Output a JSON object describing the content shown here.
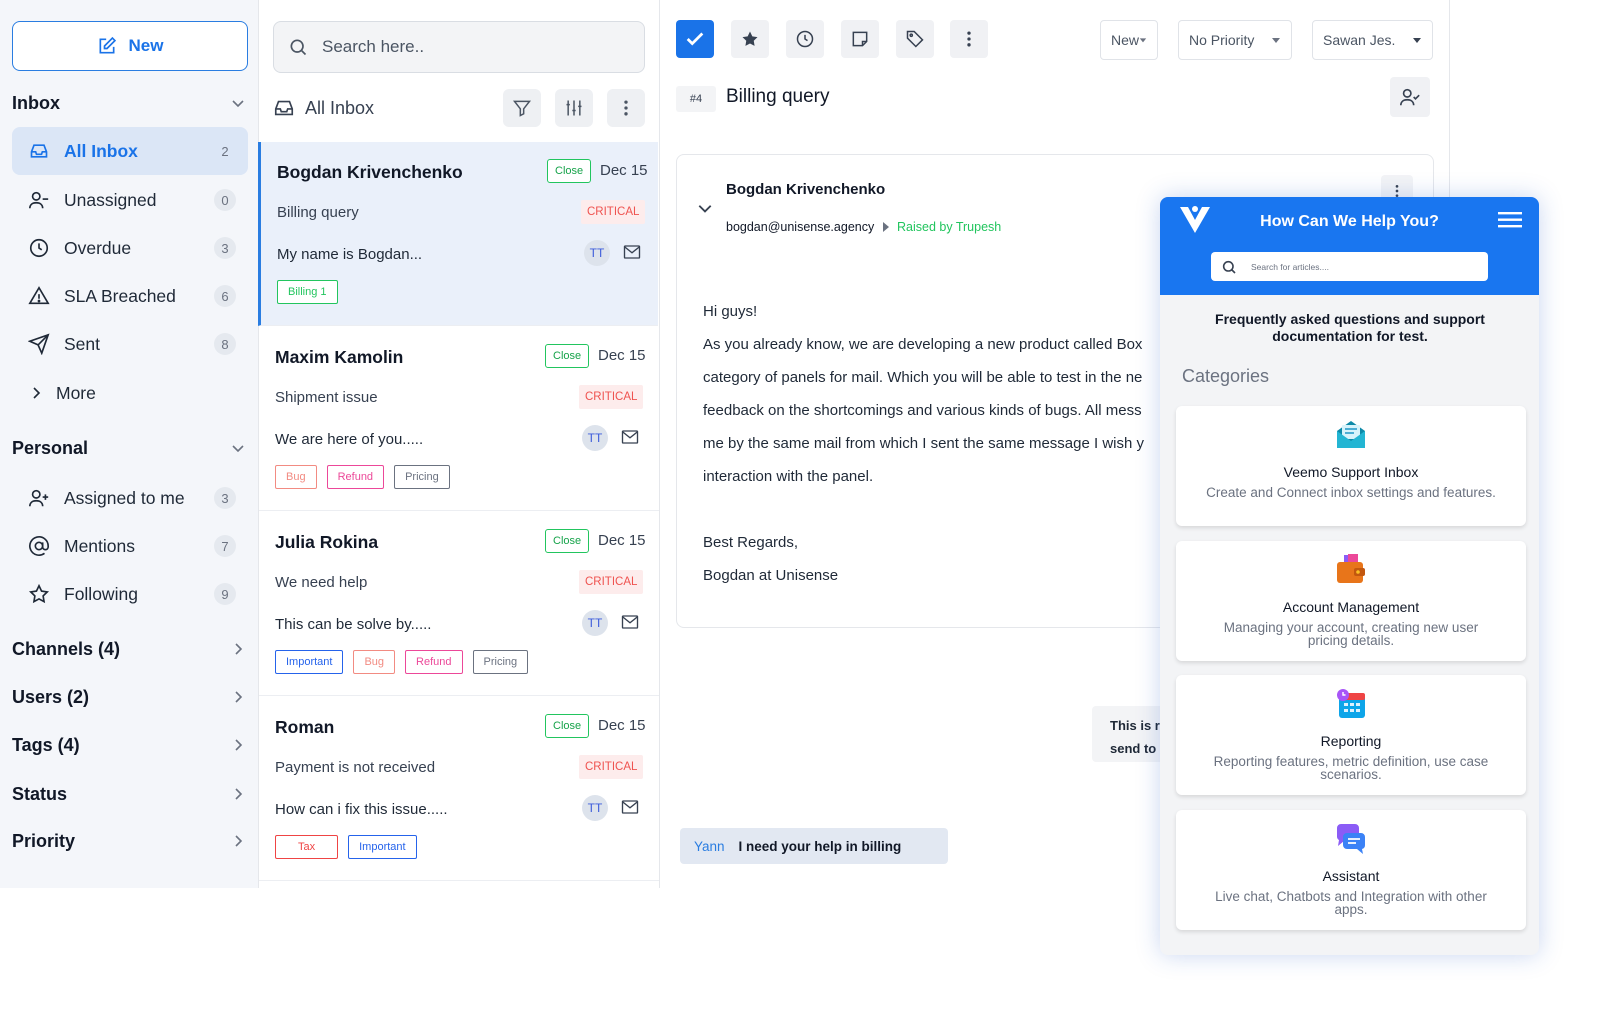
{
  "sidebar": {
    "new_label": "New",
    "inbox_header": "Inbox",
    "inbox_items": [
      {
        "label": "All Inbox",
        "count": "2"
      },
      {
        "label": "Unassigned",
        "count": "0"
      },
      {
        "label": "Overdue",
        "count": "3"
      },
      {
        "label": "SLA Breached",
        "count": "6"
      },
      {
        "label": "Sent",
        "count": "8"
      }
    ],
    "more_label": "More",
    "personal_header": "Personal",
    "personal_items": [
      {
        "label": "Assigned to me",
        "count": "3"
      },
      {
        "label": "Mentions",
        "count": "7"
      },
      {
        "label": "Following",
        "count": "9"
      }
    ],
    "sections": [
      "Channels (4)",
      "Users (2)",
      "Tags (4)",
      "Status",
      "Priority"
    ]
  },
  "list": {
    "search_placeholder": "Search here..",
    "header": "All Inbox",
    "conversations": [
      {
        "name": "Bogdan Krivenchenko",
        "status": "Close",
        "date": "Dec 15",
        "subject": "Billing query",
        "priority": "CRITICAL",
        "preview": "My name is Bogdan...",
        "initials": "TT",
        "tags": [
          "Billing 1"
        ]
      },
      {
        "name": "Maxim Kamolin",
        "status": "Close",
        "date": "Dec 15",
        "subject": "Shipment issue",
        "priority": "CRITICAL",
        "preview": "We are here of you.....",
        "initials": "TT",
        "tags": [
          "Bug",
          "Refund",
          "Pricing"
        ]
      },
      {
        "name": "Julia Rokina",
        "status": "Close",
        "date": "Dec 15",
        "subject": "We need help",
        "priority": "CRITICAL",
        "preview": "This can be solve by.....",
        "initials": "TT",
        "tags": [
          "Important",
          "Bug",
          "Refund",
          "Pricing"
        ]
      },
      {
        "name": "Roman",
        "status": "Close",
        "date": "Dec 15",
        "subject": "Payment is not received",
        "priority": "CRITICAL",
        "preview": "How can i fix this issue.....",
        "initials": "TT",
        "tags": [
          "Tax",
          "Important"
        ]
      }
    ]
  },
  "tag_colors": {
    "Billing 1": "#22c55e",
    "Bug": "#f28b82",
    "Refund": "#ec4899",
    "Pricing": "#6b7280",
    "Important": "#2563eb",
    "Tax": "#ef4444"
  },
  "detail": {
    "status_value": "New",
    "priority_value": "No Priority",
    "assignee_value": "Sawan Jes.",
    "ticket_number": "#4",
    "ticket_title": "Billing query",
    "message": {
      "from": "Bogdan Krivenchenko",
      "email": "bogdan@unisense.agency",
      "raised_by": "Raised by Trupesh",
      "lines": [
        "Hi guys!",
        "As you already know, we are developing a new product called Box",
        "category of panels for mail. Which you will be able to test in the ne",
        "feedback on the shortcomings and various kinds of bugs. All mess",
        "me by the same mail from which I sent the same message I wish y",
        "interaction with the panel.",
        "",
        "Best Regards,",
        "Bogdan at Unisense"
      ]
    },
    "note_lines": [
      "This is re",
      "send to"
    ],
    "chat": {
      "author": "Yann",
      "text": "I need your help in billing"
    }
  },
  "widget": {
    "title": "How Can We Help You?",
    "search_placeholder": "Search for articles....",
    "intro": "Frequently asked questions and support documentation for test.",
    "categories_label": "Categories",
    "cards": [
      {
        "title": "Veemo Support Inbox",
        "desc": "Create and Connect inbox settings and features.",
        "icon": "inbox-envelope-icon"
      },
      {
        "title": "Account Management",
        "desc": "Managing your account, creating new user pricing details.",
        "icon": "wallet-icon"
      },
      {
        "title": "Reporting",
        "desc": "Reporting features, metric definition, use case scenarios.",
        "icon": "calendar-clock-icon"
      },
      {
        "title": "Assistant",
        "desc": "Live chat, Chatbots and Integration with other apps.",
        "icon": "chat-bubbles-icon"
      }
    ]
  },
  "colors": {
    "accent": "#1a73e8",
    "widget_header": "#1976f0",
    "critical_bg": "#fdecec",
    "critical_text": "#ef5350",
    "close_green": "#22c55e"
  }
}
